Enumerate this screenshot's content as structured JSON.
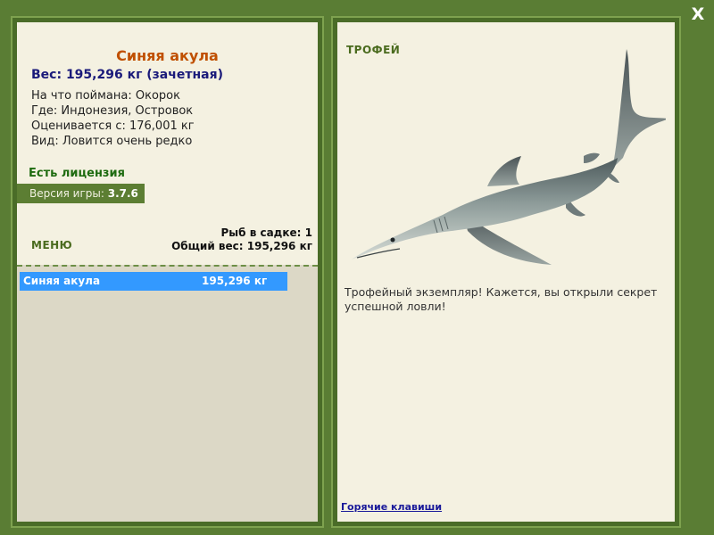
{
  "window": {
    "close_label": "X"
  },
  "fish": {
    "name": "Синяя акула",
    "weight_line": "Вес: 195,296 кг (зачетная)",
    "caught_with": "На что поймана: Окорок",
    "location": "Где: Индонезия, Островок",
    "valued_from": "Оценивается с: 176,001 кг",
    "rarity": "Вид: Ловится очень редко"
  },
  "license": "Есть лицензия",
  "version": {
    "label": "Версия игры:",
    "value": "3.7.6"
  },
  "menu_label": "МЕНЮ",
  "keepnet": {
    "count_line": "Рыб в садке: 1",
    "total_line": "Общий вес: 195,296 кг",
    "items": [
      {
        "name": "Синяя акула",
        "weight": "195,296 кг"
      }
    ]
  },
  "trophy": {
    "label": "ТРОФЕЙ",
    "image": "blue-shark-illustration",
    "text": "Трофейный экземпляр! Кажется, вы открыли секрет успешной ловли!"
  },
  "hotkeys_label": "Горячие клавиши",
  "colors": {
    "background": "#5a7d34",
    "panel": "#f4f1e1",
    "title": "#c05000",
    "selection": "#3399ff"
  }
}
